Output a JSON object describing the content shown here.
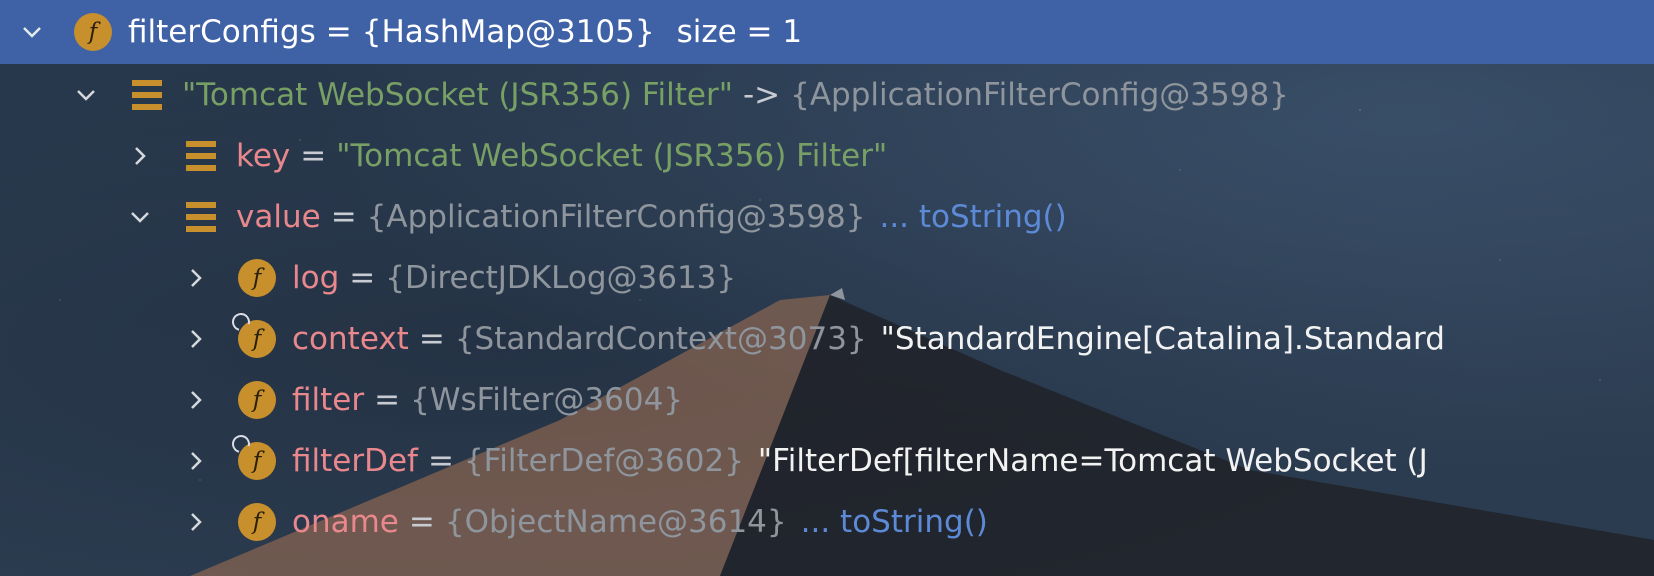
{
  "rows": [
    {
      "name": "filterConfigs",
      "value": "{HashMap@3105}",
      "extra": "size = 1"
    },
    {
      "key_string": "\"Tomcat WebSocket (JSR356) Filter\"",
      "op": "->",
      "value": "{ApplicationFilterConfig@3598}"
    },
    {
      "name": "key",
      "value": "\"Tomcat WebSocket (JSR356) Filter\""
    },
    {
      "name": "value",
      "value": "{ApplicationFilterConfig@3598}",
      "link": "... toString()"
    },
    {
      "name": "log",
      "value": "{DirectJDKLog@3613}"
    },
    {
      "name": "context",
      "value": "{StandardContext@3073}",
      "extra": "\"StandardEngine[Catalina].Standard"
    },
    {
      "name": "filter",
      "value": "{WsFilter@3604}"
    },
    {
      "name": "filterDef",
      "value": "{FilterDef@3602}",
      "extra": "\"FilterDef[filterName=Tomcat WebSocket (J"
    },
    {
      "name": "oname",
      "value": "{ObjectName@3614}",
      "link": "... toString()"
    }
  ],
  "eq": "=",
  "field_icon_letter": "f",
  "colors": {
    "selection": "#3f61a6",
    "field_name": "#e8878c",
    "string": "#78a064",
    "object_ref": "#8f959d",
    "link": "#5c8ad6",
    "icon": "#c7902c"
  }
}
